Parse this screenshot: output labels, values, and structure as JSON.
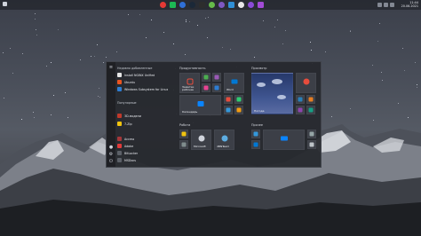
{
  "taskbar": {
    "pinned_icons": [
      {
        "name": "chrome-icon",
        "color": "#e53935"
      },
      {
        "name": "spotify-icon",
        "color": "#1db954"
      },
      {
        "name": "edge-icon",
        "color": "#2f6fd6"
      },
      {
        "name": "steam-icon",
        "color": "#1b2838"
      },
      {
        "name": "terminal-icon",
        "color": "#2d2d2d"
      },
      {
        "name": "app-green-icon",
        "color": "#66bb4a"
      },
      {
        "name": "app-purple-icon",
        "color": "#7e57c2"
      },
      {
        "name": "app-blue-icon",
        "color": "#2f8fd6"
      },
      {
        "name": "app-white-icon",
        "color": "#e7e7e7"
      },
      {
        "name": "app-violet-icon",
        "color": "#8a4bd6"
      },
      {
        "name": "app-purple2-icon",
        "color": "#a24bd6"
      }
    ],
    "clock_time": "11:44",
    "clock_date": "20.06.2021"
  },
  "start_menu": {
    "recent_header": "Недавно добавленные",
    "recent": [
      {
        "label": "Install NGINX Unified",
        "color": "#e6e6e6"
      },
      {
        "label": "Ubuntu",
        "color": "#e95420"
      },
      {
        "label": "Windows Subsystem for Linux",
        "color": "#2d7dd2"
      }
    ],
    "popular_header": "Популярные",
    "popular": [
      {
        "label": "3D-модели",
        "color": "#c0392b"
      },
      {
        "label": "7-Zip",
        "color": "#f1c40f"
      },
      {
        "label": "Access",
        "color": "#a4373a"
      },
      {
        "label": "Adobe",
        "color": "#e03a3a"
      },
      {
        "label": "BitLocker",
        "color": "#5c6068"
      },
      {
        "label": "MSDocs",
        "color": "#5c6068"
      }
    ],
    "group_productivity": "Продуктивность",
    "group_explore": "Просмотр",
    "group_work": "Работа",
    "group_other": "Прочее",
    "tile_office": "Office",
    "tile_calendar": "Календарь",
    "tile_notes": "Заметки\nрабочее",
    "tile_weather": "Погода",
    "tile_store": "Microsoft",
    "tile_net": "dBNTeam",
    "tile_word": "Word"
  }
}
